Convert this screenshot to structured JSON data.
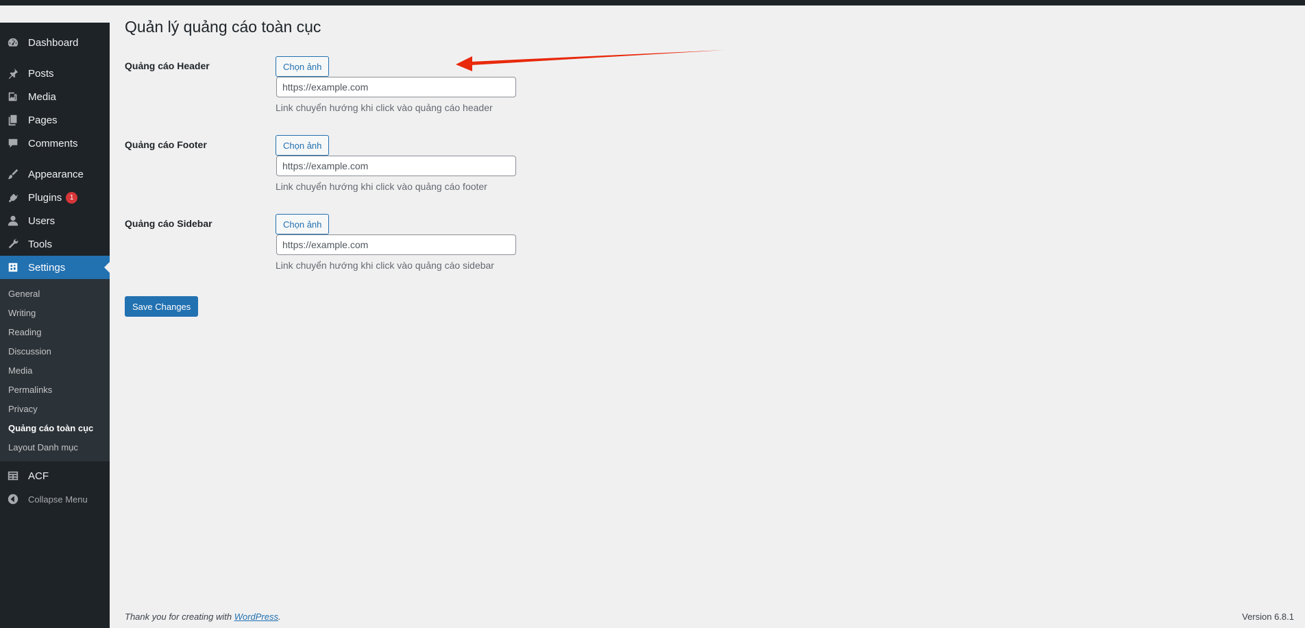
{
  "sidebar": {
    "items": [
      {
        "label": "Dashboard",
        "icon": "dashboard-icon"
      },
      {
        "label": "Posts",
        "icon": "pin-icon"
      },
      {
        "label": "Media",
        "icon": "media-icon"
      },
      {
        "label": "Pages",
        "icon": "pages-icon"
      },
      {
        "label": "Comments",
        "icon": "comment-icon"
      },
      {
        "label": "Appearance",
        "icon": "brush-icon"
      },
      {
        "label": "Plugins",
        "icon": "plug-icon",
        "badge": "1"
      },
      {
        "label": "Users",
        "icon": "user-icon"
      },
      {
        "label": "Tools",
        "icon": "wrench-icon"
      },
      {
        "label": "Settings",
        "icon": "settings-icon"
      }
    ],
    "submenu": [
      "General",
      "Writing",
      "Reading",
      "Discussion",
      "Media",
      "Permalinks",
      "Privacy",
      "Quảng cáo toàn cục",
      "Layout Danh mục"
    ],
    "acf": {
      "label": "ACF",
      "icon": "table-icon"
    },
    "collapse": {
      "label": "Collapse Menu",
      "icon": "collapse-icon"
    }
  },
  "page": {
    "title": "Quản lý quảng cáo toàn cục",
    "rows": [
      {
        "label": "Quảng cáo Header",
        "button": "Chọn ảnh",
        "placeholder": "https://example.com",
        "desc": "Link chuyển hướng khi click vào quảng cáo header"
      },
      {
        "label": "Quảng cáo Footer",
        "button": "Chọn ảnh",
        "placeholder": "https://example.com",
        "desc": "Link chuyển hướng khi click vào quảng cáo footer"
      },
      {
        "label": "Quảng cáo Sidebar",
        "button": "Chọn ảnh",
        "placeholder": "https://example.com",
        "desc": "Link chuyển hướng khi click vào quảng cáo sidebar"
      }
    ],
    "save_label": "Save Changes"
  },
  "footer": {
    "thanks": "Thank you for creating with",
    "link": "WordPress",
    "period": ".",
    "version": "Version 6.8.1"
  },
  "colors": {
    "accent": "#2271b1",
    "sidebar": "#1d2327",
    "arrow": "#e8290b"
  }
}
